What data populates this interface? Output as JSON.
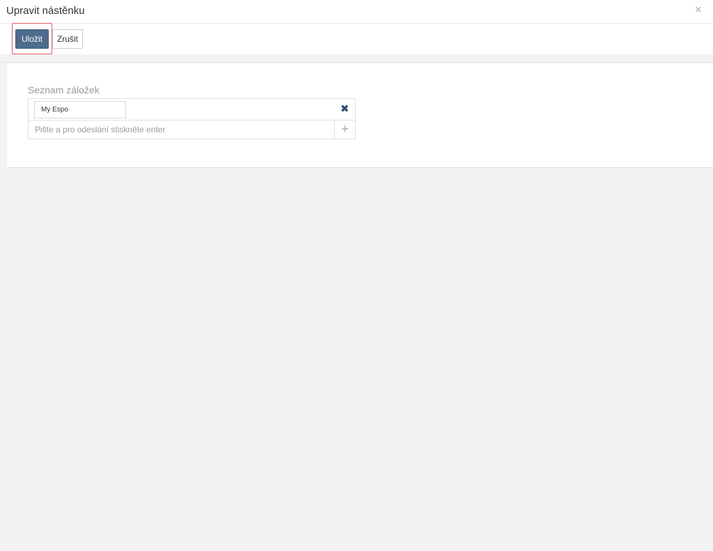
{
  "dialog": {
    "title": "Upravit nástěnku",
    "close_icon": "close-icon",
    "close_glyph": "×"
  },
  "toolbar": {
    "save_label": "Uložit",
    "cancel_label": "Zrušit"
  },
  "form": {
    "tab_list_label": "Seznam záložek",
    "tabs": [
      {
        "value": "My Espo",
        "remove_glyph": "✖"
      }
    ],
    "new_tab_placeholder": "Pište a pro odeslání stiskněte enter",
    "add_glyph": "+"
  },
  "colors": {
    "primary": "#4e6c8c",
    "highlight_outline": "#e05c6a",
    "background": "#f2f2f2"
  }
}
